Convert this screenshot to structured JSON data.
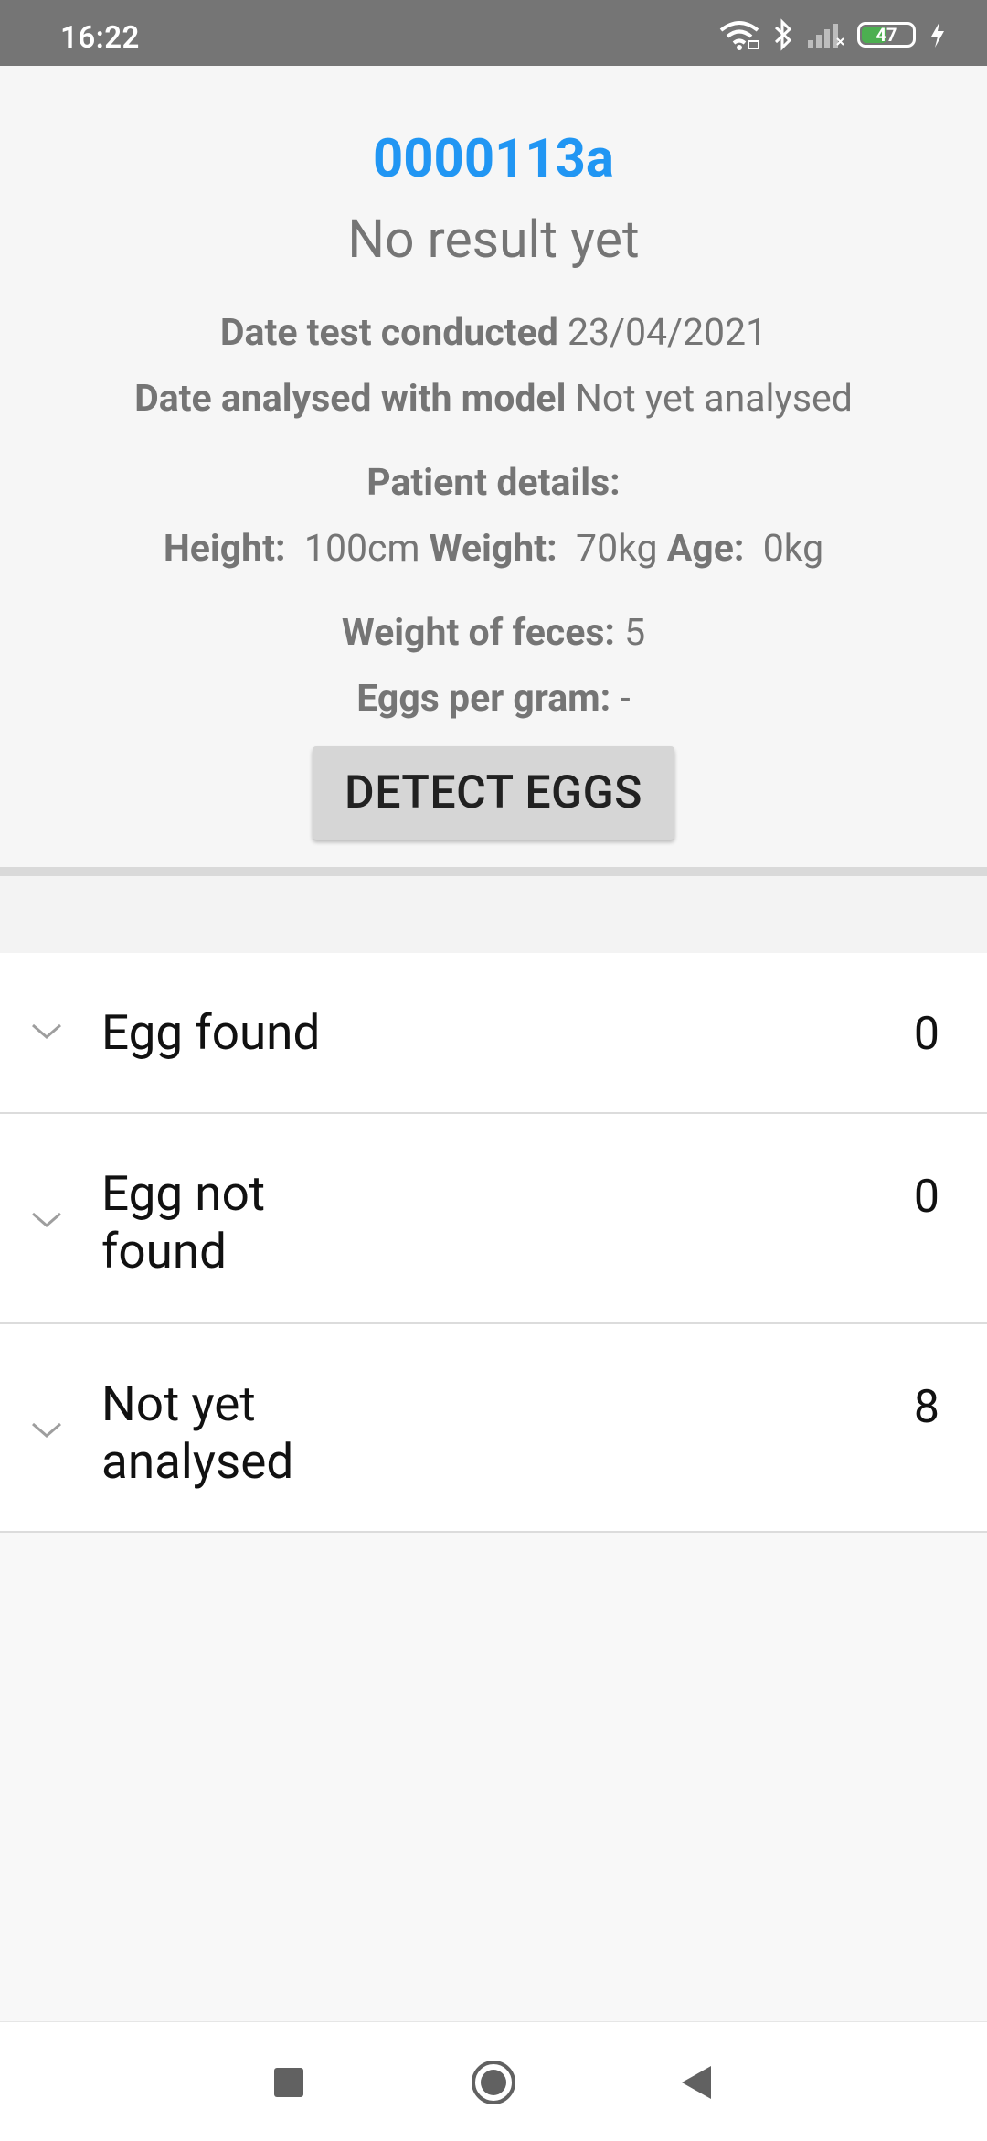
{
  "status_bar": {
    "time": "16:22",
    "battery_level": "47",
    "icons": [
      "wifi-icon",
      "bluetooth-icon",
      "signal-icon",
      "battery-icon",
      "charging-icon"
    ]
  },
  "sample": {
    "id": "0000113a",
    "result": "No result yet",
    "date_conducted_label": "Date test conducted",
    "date_conducted_value": "23/04/2021",
    "date_analysed_label": "Date analysed with model",
    "date_analysed_value": "Not yet analysed",
    "patient_details_label": "Patient details:",
    "height_label": "Height:",
    "height_value": "100cm",
    "weight_label": "Weight:",
    "weight_value": "70kg",
    "age_label": "Age:",
    "age_value": "0kg",
    "feces_weight_label": "Weight of feces:",
    "feces_weight_value": "5",
    "eggs_per_gram_label": "Eggs per gram:",
    "eggs_per_gram_value": "-"
  },
  "actions": {
    "detect_label": "DETECT EGGS"
  },
  "groups": [
    {
      "label": "Egg found",
      "count": "0"
    },
    {
      "label": "Egg not found",
      "count": "0"
    },
    {
      "label": "Not yet analysed",
      "count": "8"
    }
  ],
  "colors": {
    "accent": "#2196f3",
    "status_bar": "#757575",
    "battery": "#4caf50"
  }
}
